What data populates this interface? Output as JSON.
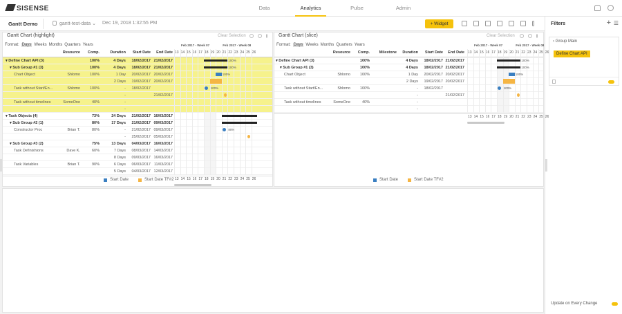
{
  "nav": {
    "logo": "SISENSE",
    "tabs": [
      {
        "label": "Data",
        "active": false
      },
      {
        "label": "Analytics",
        "active": true
      },
      {
        "label": "Pulse",
        "active": false
      },
      {
        "label": "Admin",
        "active": false
      }
    ]
  },
  "dashboard": {
    "title": "Gantt Demo",
    "datasource": "gantt-test-data",
    "timestamp": "Dec 19, 2018 1:32:55 PM",
    "widget_button": "+ Widget"
  },
  "filters": {
    "title": "Filters",
    "group": "Group Main",
    "chip": "Define Chart API",
    "footer": "Update on Every Change"
  },
  "formats": [
    "Format:",
    "Days",
    "Weeks",
    "Months",
    "Quarters",
    "Years"
  ],
  "selected_format": "Days",
  "weeks": [
    "Feb 2017 - Week 07",
    "Feb 2017 - Week 08"
  ],
  "days": [
    "13",
    "14",
    "15",
    "16",
    "17",
    "18",
    "19",
    "20",
    "21",
    "22",
    "23",
    "24",
    "25",
    "26"
  ],
  "legend": [
    {
      "name": "Start Date",
      "color": "#3a7fc1"
    },
    {
      "name": "Start Date TF#2",
      "color": "#f5b544"
    }
  ],
  "widget_left": {
    "title": "Gantt Chart (highlight)",
    "clear": "Clear Selection",
    "headers": [
      "",
      "Resource",
      "Comp.",
      "Duration",
      "Start Date",
      "End Date"
    ],
    "rows": [
      {
        "cells": [
          "▾ Define Chart API (3)",
          "",
          "100%",
          "4 Days",
          "18/02/2017",
          "21/02/2017"
        ],
        "level": 0,
        "bold": true,
        "hl": true
      },
      {
        "cells": [
          "▾ Sub Group #1 (3)",
          "",
          "100%",
          "4 Days",
          "18/02/2017",
          "21/02/2017"
        ],
        "level": 1,
        "bold": true,
        "hl": true
      },
      {
        "cells": [
          "Chart Object",
          "Shlomo",
          "100%",
          "1 Day",
          "20/02/2017",
          "20/02/2017"
        ],
        "level": 2,
        "bold": false,
        "hl": true
      },
      {
        "cells": [
          "",
          "",
          "",
          "2 Days",
          "19/02/2017",
          "20/02/2017"
        ],
        "level": 2,
        "bold": false,
        "hl": true
      },
      {
        "cells": [
          "Task without Start/En...",
          "Shlomo",
          "100%",
          "-",
          "18/02/2017",
          ""
        ],
        "level": 2,
        "bold": false,
        "hl": true
      },
      {
        "cells": [
          "",
          "",
          "",
          "-",
          "",
          "21/02/2017"
        ],
        "level": 2,
        "bold": false,
        "hl": true
      },
      {
        "cells": [
          "Task without timelines",
          "SomeOne",
          "40%",
          "-",
          "",
          ""
        ],
        "level": 2,
        "bold": false,
        "hl": true
      },
      {
        "cells": [
          "",
          "",
          "",
          "-",
          "",
          ""
        ],
        "level": 2,
        "bold": false,
        "hl": true
      },
      {
        "cells": [
          "▾ Task Objects (4)",
          "",
          "73%",
          "24 Days",
          "21/02/2017",
          "16/03/2017"
        ],
        "level": 0,
        "bold": true,
        "hl": false
      },
      {
        "cells": [
          "▾ Sub Group #2 (1)",
          "",
          "80%",
          "17 Days",
          "21/02/2017",
          "09/03/2017"
        ],
        "level": 1,
        "bold": true,
        "hl": false
      },
      {
        "cells": [
          "Constructor Proc",
          "Brian T.",
          "80%",
          "-",
          "21/02/2017",
          "09/03/2017"
        ],
        "level": 2,
        "bold": false,
        "hl": false
      },
      {
        "cells": [
          "",
          "",
          "",
          "-",
          "25/02/2017",
          "05/03/2017"
        ],
        "level": 2,
        "bold": false,
        "hl": false
      },
      {
        "cells": [
          "▾ Sub Group #3 (2)",
          "",
          "75%",
          "13 Days",
          "04/03/2017",
          "16/03/2017"
        ],
        "level": 1,
        "bold": true,
        "hl": false
      },
      {
        "cells": [
          "Task Definishions",
          "Dave K.",
          "60%",
          "7 Days",
          "08/03/2017",
          "14/03/2017"
        ],
        "level": 2,
        "bold": false,
        "hl": false
      },
      {
        "cells": [
          "",
          "",
          "",
          "8 Days",
          "09/03/2017",
          "16/03/2017"
        ],
        "level": 2,
        "bold": false,
        "hl": false
      },
      {
        "cells": [
          "Task Variables",
          "Brian T.",
          "90%",
          "6 Days",
          "06/03/2017",
          "11/03/2017"
        ],
        "level": 2,
        "bold": false,
        "hl": false
      },
      {
        "cells": [
          "",
          "",
          "",
          "5 Days",
          "04/03/2017",
          "12/03/2017"
        ],
        "level": 2,
        "bold": false,
        "hl": false
      }
    ],
    "bars": [
      {
        "row": 0,
        "kind": "summary",
        "start": 18,
        "end": 21,
        "label": "100%"
      },
      {
        "row": 1,
        "kind": "summary",
        "start": 18,
        "end": 21,
        "label": "100%"
      },
      {
        "row": 2,
        "kind": "blue",
        "start": 20,
        "end": 20,
        "label": "100%"
      },
      {
        "row": 3,
        "kind": "orange",
        "start": 19,
        "end": 20,
        "label": ""
      },
      {
        "row": 4,
        "kind": "blue-dot",
        "start": 18,
        "end": 18,
        "label": "100%"
      },
      {
        "row": 5,
        "kind": "orange-dot",
        "start": 21,
        "end": 21,
        "label": ""
      },
      {
        "row": 8,
        "kind": "summary",
        "start": 21,
        "end": 26,
        "label": ""
      },
      {
        "row": 9,
        "kind": "summary",
        "start": 21,
        "end": 26,
        "label": ""
      },
      {
        "row": 10,
        "kind": "blue-dot",
        "start": 21,
        "end": 21,
        "label": "80%"
      },
      {
        "row": 11,
        "kind": "orange-dot",
        "start": 25,
        "end": 25,
        "label": ""
      }
    ]
  },
  "widget_right": {
    "title": "Gantt Chart (slice)",
    "clear": "Clear Selection",
    "headers": [
      "",
      "Resource",
      "Comp.",
      "Milestone",
      "Duration",
      "Start Date",
      "End Date"
    ],
    "rows": [
      {
        "cells": [
          "▾ Define Chart API (3)",
          "",
          "100%",
          "",
          "4 Days",
          "18/02/2017",
          "21/02/2017"
        ],
        "level": 0,
        "bold": true
      },
      {
        "cells": [
          "▾ Sub Group #1 (3)",
          "",
          "100%",
          "",
          "4 Days",
          "18/02/2017",
          "21/02/2017"
        ],
        "level": 1,
        "bold": true
      },
      {
        "cells": [
          "Chart Object",
          "Shlomo",
          "100%",
          "",
          "1 Day",
          "20/02/2017",
          "20/02/2017"
        ],
        "level": 2,
        "bold": false
      },
      {
        "cells": [
          "",
          "",
          "",
          "",
          "2 Days",
          "19/02/2017",
          "20/02/2017"
        ],
        "level": 2,
        "bold": false
      },
      {
        "cells": [
          "Task without Start/En...",
          "Shlomo",
          "100%",
          "",
          "-",
          "18/02/2017",
          ""
        ],
        "level": 2,
        "bold": false
      },
      {
        "cells": [
          "",
          "",
          "",
          "",
          "-",
          "",
          "21/02/2017"
        ],
        "level": 2,
        "bold": false
      },
      {
        "cells": [
          "Task without timelines",
          "SomeOne",
          "40%",
          "",
          "-",
          "",
          ""
        ],
        "level": 2,
        "bold": false
      },
      {
        "cells": [
          "",
          "",
          "",
          "",
          "-",
          "",
          ""
        ],
        "level": 2,
        "bold": false
      }
    ],
    "bars": [
      {
        "row": 0,
        "kind": "summary",
        "start": 18,
        "end": 21,
        "label": "100%"
      },
      {
        "row": 1,
        "kind": "summary",
        "start": 18,
        "end": 21,
        "label": "100%"
      },
      {
        "row": 2,
        "kind": "blue",
        "start": 20,
        "end": 20,
        "label": "100%"
      },
      {
        "row": 3,
        "kind": "orange",
        "start": 19,
        "end": 20,
        "label": ""
      },
      {
        "row": 4,
        "kind": "blue-dot",
        "start": 18,
        "end": 18,
        "label": "100%"
      },
      {
        "row": 5,
        "kind": "orange-dot",
        "start": 21,
        "end": 21,
        "label": ""
      }
    ]
  }
}
